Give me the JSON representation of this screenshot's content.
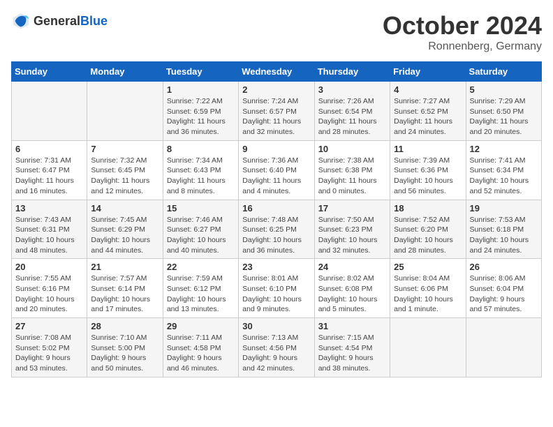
{
  "header": {
    "logo_general": "General",
    "logo_blue": "Blue",
    "title": "October 2024",
    "location": "Ronnenberg, Germany"
  },
  "calendar": {
    "days_of_week": [
      "Sunday",
      "Monday",
      "Tuesday",
      "Wednesday",
      "Thursday",
      "Friday",
      "Saturday"
    ],
    "weeks": [
      [
        {
          "day": "",
          "content": ""
        },
        {
          "day": "",
          "content": ""
        },
        {
          "day": "1",
          "content": "Sunrise: 7:22 AM\nSunset: 6:59 PM\nDaylight: 11 hours\nand 36 minutes."
        },
        {
          "day": "2",
          "content": "Sunrise: 7:24 AM\nSunset: 6:57 PM\nDaylight: 11 hours\nand 32 minutes."
        },
        {
          "day": "3",
          "content": "Sunrise: 7:26 AM\nSunset: 6:54 PM\nDaylight: 11 hours\nand 28 minutes."
        },
        {
          "day": "4",
          "content": "Sunrise: 7:27 AM\nSunset: 6:52 PM\nDaylight: 11 hours\nand 24 minutes."
        },
        {
          "day": "5",
          "content": "Sunrise: 7:29 AM\nSunset: 6:50 PM\nDaylight: 11 hours\nand 20 minutes."
        }
      ],
      [
        {
          "day": "6",
          "content": "Sunrise: 7:31 AM\nSunset: 6:47 PM\nDaylight: 11 hours\nand 16 minutes."
        },
        {
          "day": "7",
          "content": "Sunrise: 7:32 AM\nSunset: 6:45 PM\nDaylight: 11 hours\nand 12 minutes."
        },
        {
          "day": "8",
          "content": "Sunrise: 7:34 AM\nSunset: 6:43 PM\nDaylight: 11 hours\nand 8 minutes."
        },
        {
          "day": "9",
          "content": "Sunrise: 7:36 AM\nSunset: 6:40 PM\nDaylight: 11 hours\nand 4 minutes."
        },
        {
          "day": "10",
          "content": "Sunrise: 7:38 AM\nSunset: 6:38 PM\nDaylight: 11 hours\nand 0 minutes."
        },
        {
          "day": "11",
          "content": "Sunrise: 7:39 AM\nSunset: 6:36 PM\nDaylight: 10 hours\nand 56 minutes."
        },
        {
          "day": "12",
          "content": "Sunrise: 7:41 AM\nSunset: 6:34 PM\nDaylight: 10 hours\nand 52 minutes."
        }
      ],
      [
        {
          "day": "13",
          "content": "Sunrise: 7:43 AM\nSunset: 6:31 PM\nDaylight: 10 hours\nand 48 minutes."
        },
        {
          "day": "14",
          "content": "Sunrise: 7:45 AM\nSunset: 6:29 PM\nDaylight: 10 hours\nand 44 minutes."
        },
        {
          "day": "15",
          "content": "Sunrise: 7:46 AM\nSunset: 6:27 PM\nDaylight: 10 hours\nand 40 minutes."
        },
        {
          "day": "16",
          "content": "Sunrise: 7:48 AM\nSunset: 6:25 PM\nDaylight: 10 hours\nand 36 minutes."
        },
        {
          "day": "17",
          "content": "Sunrise: 7:50 AM\nSunset: 6:23 PM\nDaylight: 10 hours\nand 32 minutes."
        },
        {
          "day": "18",
          "content": "Sunrise: 7:52 AM\nSunset: 6:20 PM\nDaylight: 10 hours\nand 28 minutes."
        },
        {
          "day": "19",
          "content": "Sunrise: 7:53 AM\nSunset: 6:18 PM\nDaylight: 10 hours\nand 24 minutes."
        }
      ],
      [
        {
          "day": "20",
          "content": "Sunrise: 7:55 AM\nSunset: 6:16 PM\nDaylight: 10 hours\nand 20 minutes."
        },
        {
          "day": "21",
          "content": "Sunrise: 7:57 AM\nSunset: 6:14 PM\nDaylight: 10 hours\nand 17 minutes."
        },
        {
          "day": "22",
          "content": "Sunrise: 7:59 AM\nSunset: 6:12 PM\nDaylight: 10 hours\nand 13 minutes."
        },
        {
          "day": "23",
          "content": "Sunrise: 8:01 AM\nSunset: 6:10 PM\nDaylight: 10 hours\nand 9 minutes."
        },
        {
          "day": "24",
          "content": "Sunrise: 8:02 AM\nSunset: 6:08 PM\nDaylight: 10 hours\nand 5 minutes."
        },
        {
          "day": "25",
          "content": "Sunrise: 8:04 AM\nSunset: 6:06 PM\nDaylight: 10 hours\nand 1 minute."
        },
        {
          "day": "26",
          "content": "Sunrise: 8:06 AM\nSunset: 6:04 PM\nDaylight: 9 hours\nand 57 minutes."
        }
      ],
      [
        {
          "day": "27",
          "content": "Sunrise: 7:08 AM\nSunset: 5:02 PM\nDaylight: 9 hours\nand 53 minutes."
        },
        {
          "day": "28",
          "content": "Sunrise: 7:10 AM\nSunset: 5:00 PM\nDaylight: 9 hours\nand 50 minutes."
        },
        {
          "day": "29",
          "content": "Sunrise: 7:11 AM\nSunset: 4:58 PM\nDaylight: 9 hours\nand 46 minutes."
        },
        {
          "day": "30",
          "content": "Sunrise: 7:13 AM\nSunset: 4:56 PM\nDaylight: 9 hours\nand 42 minutes."
        },
        {
          "day": "31",
          "content": "Sunrise: 7:15 AM\nSunset: 4:54 PM\nDaylight: 9 hours\nand 38 minutes."
        },
        {
          "day": "",
          "content": ""
        },
        {
          "day": "",
          "content": ""
        }
      ]
    ]
  }
}
